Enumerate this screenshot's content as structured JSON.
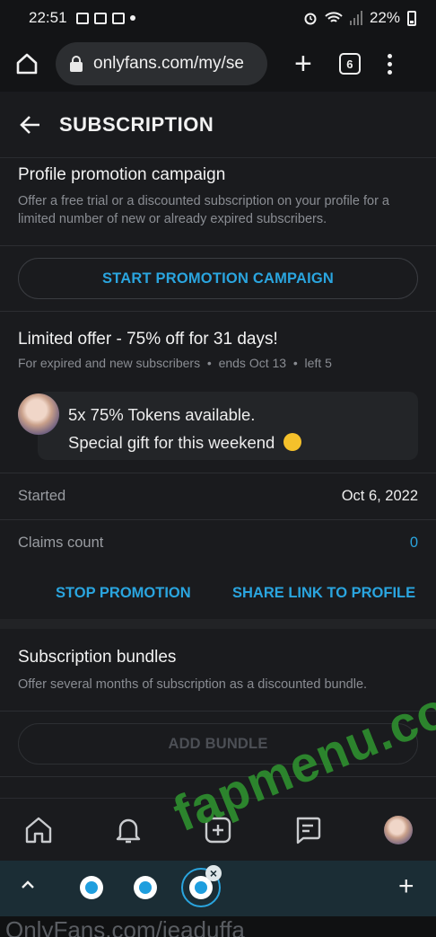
{
  "status_bar": {
    "time": "22:51",
    "battery": "22%"
  },
  "browser": {
    "url": "onlyfans.com/my/se",
    "tab_count": "6"
  },
  "header": {
    "title": "SUBSCRIPTION"
  },
  "promotion": {
    "title": "Profile promotion campaign",
    "description": "Offer a free trial or a discounted subscription on your profile for a limited number of new or already expired subscribers.",
    "button": "START PROMOTION CAMPAIGN"
  },
  "offer": {
    "title": "Limited offer - 75% off for 31 days!",
    "audience": "For expired and new subscribers",
    "ends": "ends Oct 13",
    "left": "left 5",
    "message_line1": "5x 75% Tokens available.",
    "message_line2": "Special gift for this weekend",
    "started_label": "Started",
    "started_value": "Oct 6, 2022",
    "claims_label": "Claims count",
    "claims_value": "0",
    "stop_button": "STOP PROMOTION",
    "share_button": "SHARE LINK TO PROFILE"
  },
  "bundles": {
    "title": "Subscription bundles",
    "description": "Offer several months of subscription as a discounted bundle.",
    "button": "ADD BUNDLE"
  },
  "watermark": "fapmenu.com",
  "gesture_url": "OnlyFans.com/jeaduffa",
  "icons": [
    "home-icon",
    "bell-icon",
    "plus-square-icon",
    "chat-icon",
    "avatar"
  ],
  "colors": {
    "accent": "#2aa5df",
    "background": "#1a1b1e",
    "watermark": "#2e8a2e"
  }
}
